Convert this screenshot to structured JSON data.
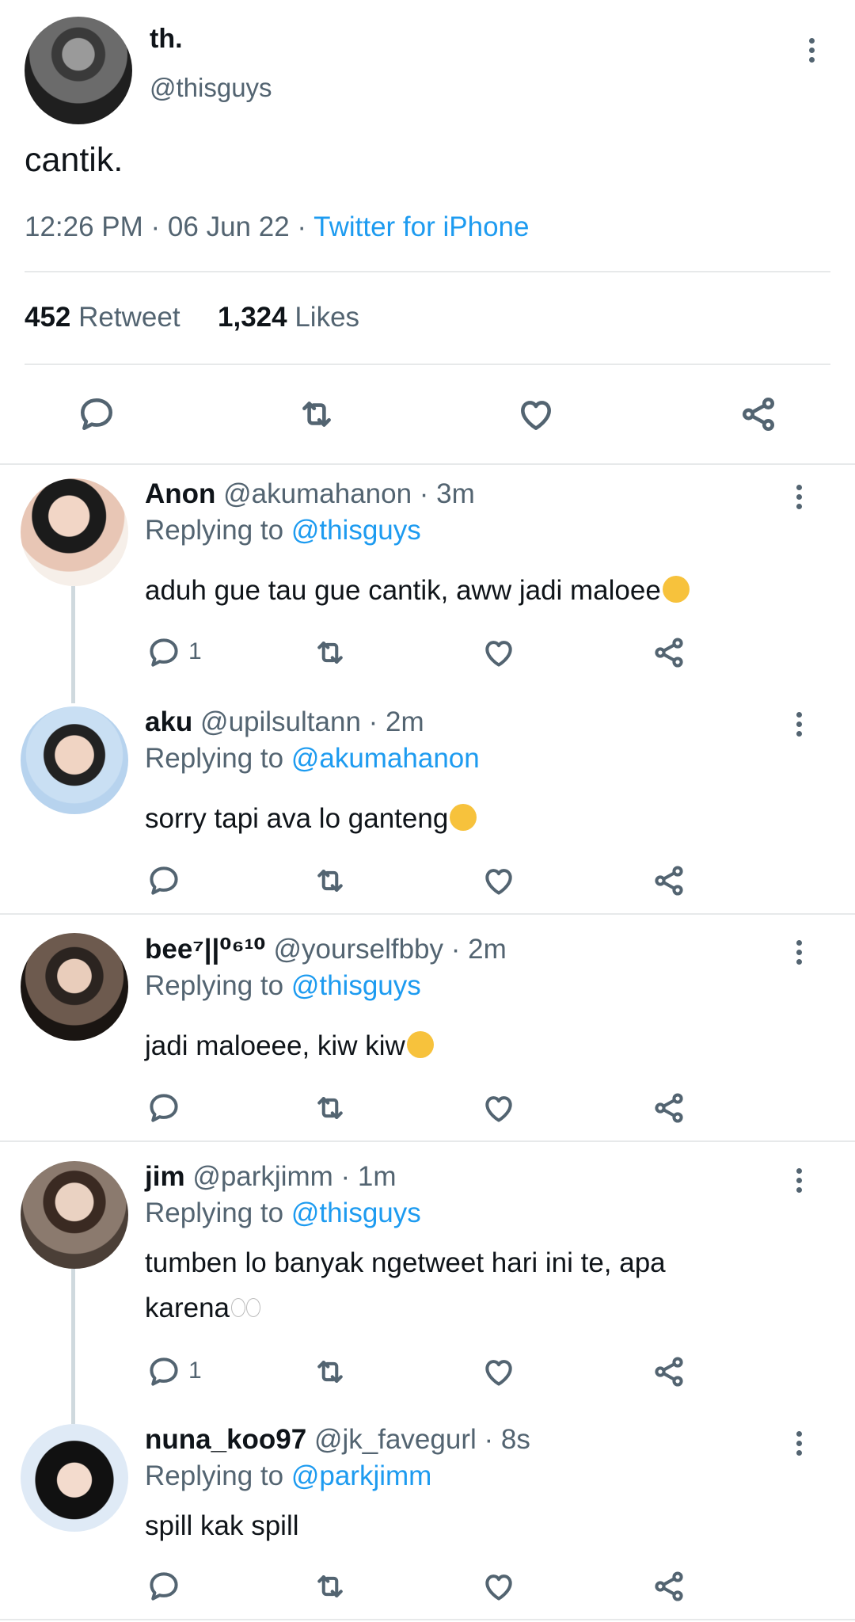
{
  "tweet": {
    "name": "th.",
    "handle": "@thisguys",
    "text": "cantik.",
    "time": "12:26 PM · 06 Jun 22 · ",
    "source": "Twitter for iPhone",
    "retweet_count": "452",
    "retweet_label": "Retweet",
    "likes_count": "1,324",
    "likes_label": "Likes"
  },
  "replies": [
    {
      "name": "Anon",
      "handle": "@akumahanon · 3m",
      "replying_prefix": "Replying to ",
      "replying_to": "@thisguys",
      "text": "aduh gue tau gue cantik, aww jadi maloee",
      "reply_count": "1",
      "emoji": "shushing-face"
    },
    {
      "name": "aku",
      "handle": "@upilsultann · 2m",
      "replying_prefix": "Replying to ",
      "replying_to": "@akumahanon",
      "text": "sorry tapi ava lo ganteng",
      "reply_count": "",
      "emoji": "crying-face"
    },
    {
      "name": "bee⁷||⁰⁶¹⁰",
      "handle": "@yourselfbby · 2m",
      "replying_prefix": "Replying to ",
      "replying_to": "@thisguys",
      "text": "jadi maloeee, kiw kiw",
      "reply_count": "",
      "emoji": "winking-face"
    },
    {
      "name": "jim",
      "handle": "@parkjimm · 1m",
      "replying_prefix": "Replying to ",
      "replying_to": "@thisguys",
      "text_line1": "tumben lo banyak ngetweet hari ini te, apa",
      "text_line2": "karena",
      "reply_count": "1",
      "emoji": "eyes"
    },
    {
      "name": "nuna_koo97",
      "handle": "@jk_favegurl · 8s",
      "replying_prefix": "Replying to ",
      "replying_to": "@parkjimm",
      "text": "spill kak spill",
      "reply_count": ""
    }
  ],
  "icons": {
    "reply": "reply-icon",
    "retweet": "retweet-icon",
    "like": "heart-icon",
    "share": "share-icon",
    "more": "more-icon"
  },
  "colors": {
    "link": "#1d9bf0",
    "muted": "#536471",
    "text": "#0f1419",
    "divider": "#e7e9ea"
  }
}
